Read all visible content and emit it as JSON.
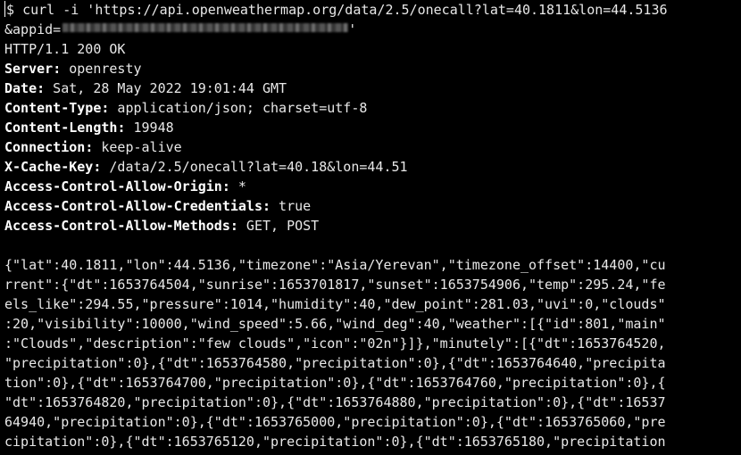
{
  "command": {
    "prompt": "$ ",
    "text": "curl -i 'https://api.openweathermap.org/data/2.5/onecall?lat=40.1811&lon=44.5136",
    "appid_prefix": "&appid=",
    "appid_suffix": "'"
  },
  "status_line": "HTTP/1.1 200 OK",
  "headers": [
    {
      "key": "Server",
      "value": " openresty"
    },
    {
      "key": "Date",
      "value": " Sat, 28 May 2022 19:01:44 GMT"
    },
    {
      "key": "Content-Type",
      "value": " application/json; charset=utf-8"
    },
    {
      "key": "Content-Length",
      "value": " 19948"
    },
    {
      "key": "Connection",
      "value": " keep-alive"
    },
    {
      "key": "X-Cache-Key",
      "value": " /data/2.5/onecall?lat=40.18&lon=44.51"
    },
    {
      "key": "Access-Control-Allow-Origin",
      "value": " *"
    },
    {
      "key": "Access-Control-Allow-Credentials",
      "value": " true"
    },
    {
      "key": "Access-Control-Allow-Methods",
      "value": " GET, POST"
    }
  ],
  "body_lines": [
    "{\"lat\":40.1811,\"lon\":44.5136,\"timezone\":\"Asia/Yerevan\",\"timezone_offset\":14400,\"cu",
    "rrent\":{\"dt\":1653764504,\"sunrise\":1653701817,\"sunset\":1653754906,\"temp\":295.24,\"fe",
    "els_like\":294.55,\"pressure\":1014,\"humidity\":40,\"dew_point\":281.03,\"uvi\":0,\"clouds\"",
    ":20,\"visibility\":10000,\"wind_speed\":5.66,\"wind_deg\":40,\"weather\":[{\"id\":801,\"main\"",
    ":\"Clouds\",\"description\":\"few clouds\",\"icon\":\"02n\"}]},\"minutely\":[{\"dt\":1653764520,",
    "\"precipitation\":0},{\"dt\":1653764580,\"precipitation\":0},{\"dt\":1653764640,\"precipita",
    "tion\":0},{\"dt\":1653764700,\"precipitation\":0},{\"dt\":1653764760,\"precipitation\":0},{",
    "\"dt\":1653764820,\"precipitation\":0},{\"dt\":1653764880,\"precipitation\":0},{\"dt\":16537",
    "64940,\"precipitation\":0},{\"dt\":1653765000,\"precipitation\":0},{\"dt\":1653765060,\"pre",
    "cipitation\":0},{\"dt\":1653765120,\"precipitation\":0},{\"dt\":1653765180,\"precipitation"
  ]
}
